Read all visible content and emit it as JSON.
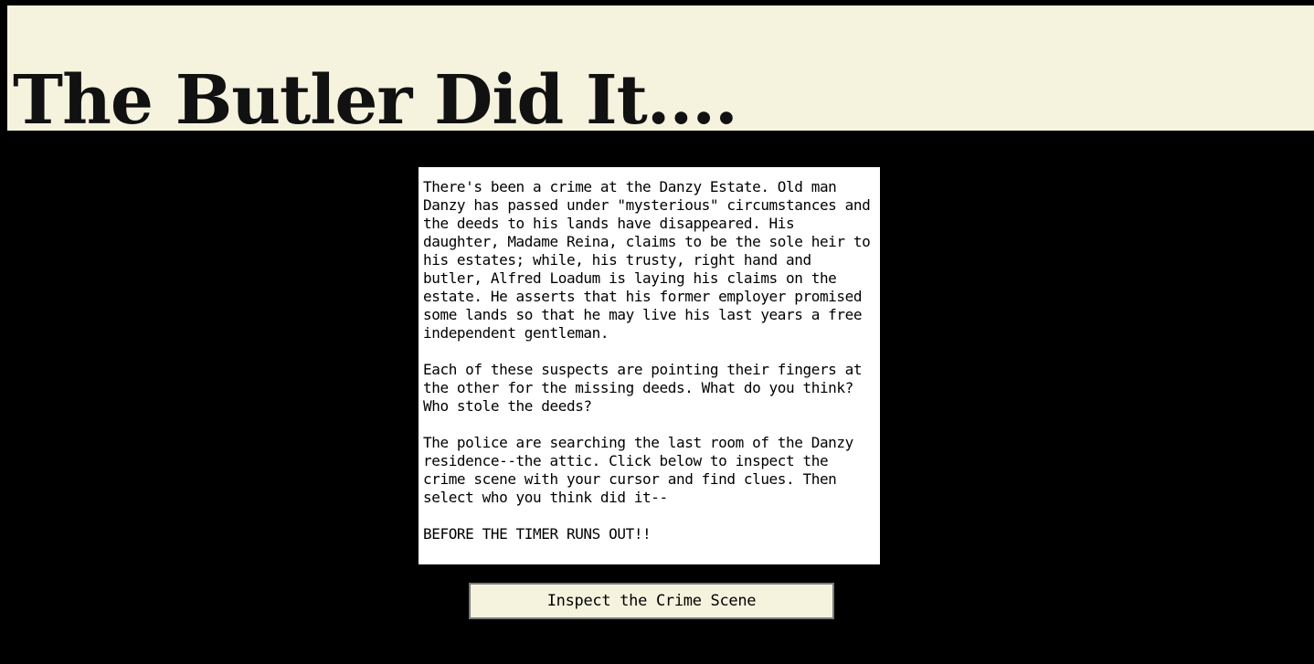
{
  "header": {
    "title": "The Butler Did It...."
  },
  "story": {
    "paragraphs": [
      "There's been a crime at the Danzy Estate. Old man Danzy has passed under \"mysterious\" circumstances and the deeds to his lands have disappeared. His daughter, Madame Reina, claims to be the sole heir to his estates; while, his trusty, right hand and butler, Alfred Loadum is laying his claims on the estate. He asserts that his former employer promised some lands so that he may live his last years a free independent gentleman.",
      "Each of these suspects are pointing their fingers at the other for the missing deeds. What do you think? Who stole the deeds?",
      "The police are searching the last room of the Danzy residence--the attic. Click below to inspect the crime scene with your cursor and find clues. Then select who you think did it--",
      "BEFORE THE TIMER RUNS OUT!!"
    ]
  },
  "actions": {
    "inspect_label": "Inspect the Crime Scene"
  },
  "colors": {
    "background": "#000000",
    "header_background": "#f5f3de",
    "story_background": "#ffffff",
    "button_background": "#f5f3de"
  }
}
